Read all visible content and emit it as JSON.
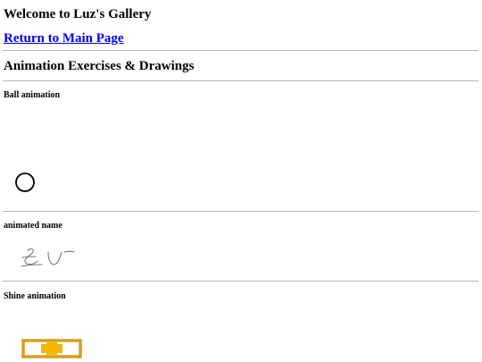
{
  "header": {
    "title": "Welcome to Luz's Gallery",
    "main_link": "Return to Main Page"
  },
  "gallery": {
    "heading": "Animation Exercises & Drawings",
    "sections": [
      {
        "label": "Ball animation"
      },
      {
        "label": "animated name"
      },
      {
        "label": "Shine animation"
      }
    ]
  },
  "colors": {
    "link": "#0000ee",
    "divider": "#b4b4b4",
    "shine_frame": "#d4a020",
    "shine_core": "#f2b800"
  }
}
